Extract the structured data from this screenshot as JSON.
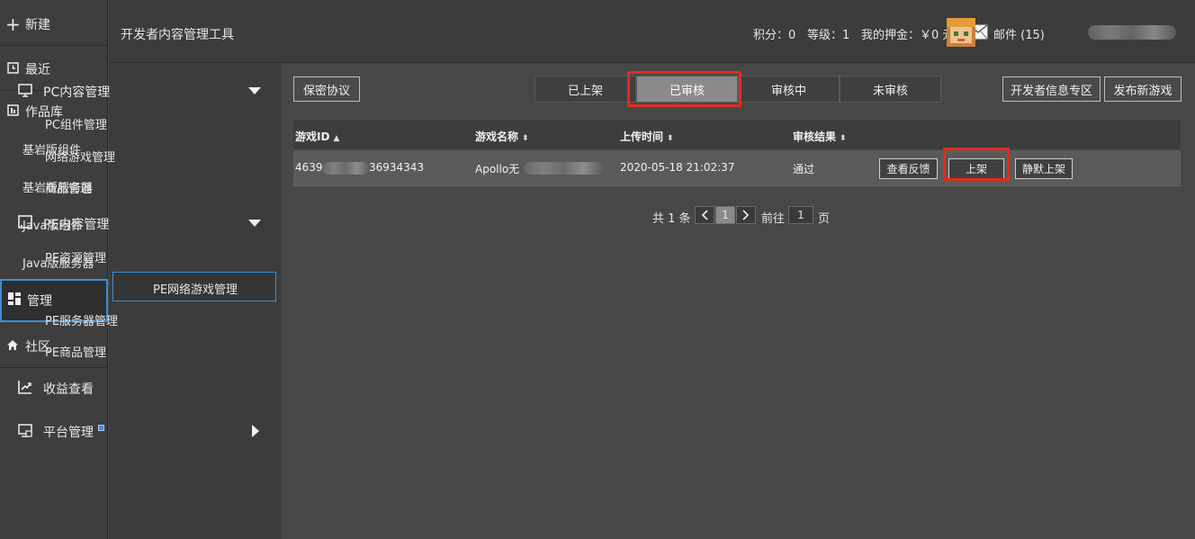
{
  "rail": {
    "new": "新建",
    "recent": "最近",
    "works": "作品库",
    "works_items": [
      "基岩版组件",
      "基岩版服务器",
      "Java版组件",
      "Java版服务器"
    ],
    "manage": "管理",
    "community": "社区"
  },
  "topbar": {
    "title": "开发者内容管理工具",
    "points": "积分：0",
    "level": "等级：1",
    "deposit": "我的押金：￥0 元",
    "mail": "邮件 (15)"
  },
  "nav": {
    "pc_group": "PC内容管理",
    "pc_items": [
      "PC组件管理",
      "网络游戏管理",
      "商品管理"
    ],
    "pe_group": "PE内容管理",
    "pe_items": [
      "PE资源管理",
      "PE网络游戏管理",
      "PE服务器管理",
      "PE商品管理"
    ],
    "revenue": "收益查看",
    "platform": "平台管理"
  },
  "toolbar": {
    "nda": "保密协议",
    "tabs": [
      "已上架",
      "已审核",
      "审核中",
      "未审核"
    ],
    "active_tab": "已审核",
    "dev_info": "开发者信息专区",
    "publish": "发布新游戏"
  },
  "table": {
    "headers": [
      "游戏ID",
      "游戏名称",
      "上传时间",
      "审核结果"
    ],
    "row": {
      "id_prefix": "4639",
      "id_suffix": "36934343",
      "name_prefix": "Apollo无",
      "upload_time": "2020-05-18 21:02:37",
      "result": "通过",
      "actions": [
        "查看反馈",
        "上架",
        "静默上架"
      ]
    }
  },
  "pagination": {
    "total": "共 1 条",
    "current": "1",
    "goto_prefix": "前往",
    "goto_value": "1",
    "goto_suffix": "页"
  },
  "colors": {
    "highlight": "#e8281c",
    "accent": "#3a8fd8",
    "active_tab": "#8a8a8a"
  }
}
